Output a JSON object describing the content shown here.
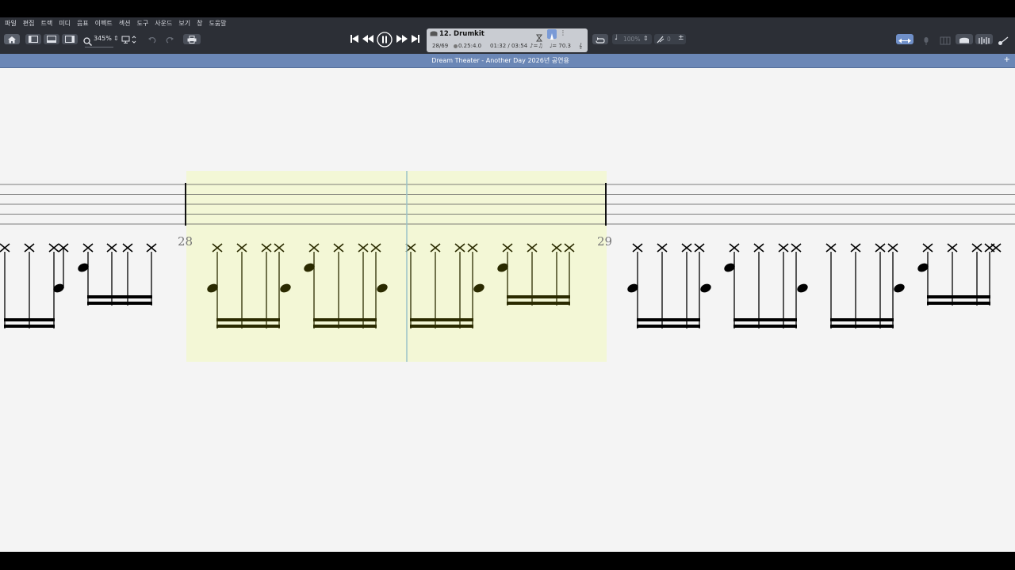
{
  "menu": [
    "파일",
    "편집",
    "트랙",
    "미디",
    "음표",
    "이펙트",
    "섹션",
    "도구",
    "사운드",
    "보기",
    "창",
    "도움말"
  ],
  "toolbar": {
    "zoom": "345%",
    "icons": [
      "home-icon",
      "panel-left-icon",
      "panel-bottom-icon",
      "panel-right-icon",
      "zoom-icon",
      "screen-mode-icon",
      "undo-icon",
      "redo-icon",
      "print-icon"
    ]
  },
  "transport": {
    "icons": [
      "skip-to-start-icon",
      "rewind-icon",
      "pause-icon",
      "fast-forward-icon",
      "skip-to-end-icon"
    ]
  },
  "track": {
    "name": "12. Drumkit",
    "bar": "28/69",
    "signature": "0.25:4.0",
    "time": "01:32 / 03:54",
    "tempo": "♩= 70.3"
  },
  "right_controls": {
    "speed": "100%",
    "pitch": "0"
  },
  "document": {
    "title": "Dream Theater - Another Day 2026년 공연용"
  },
  "score": {
    "measures": [
      "28",
      "29"
    ],
    "colors": {
      "highlight": "#f3f7d6",
      "cursor": "#9bc4c8",
      "note": "#000000",
      "active_note": "#2a2a00"
    }
  }
}
